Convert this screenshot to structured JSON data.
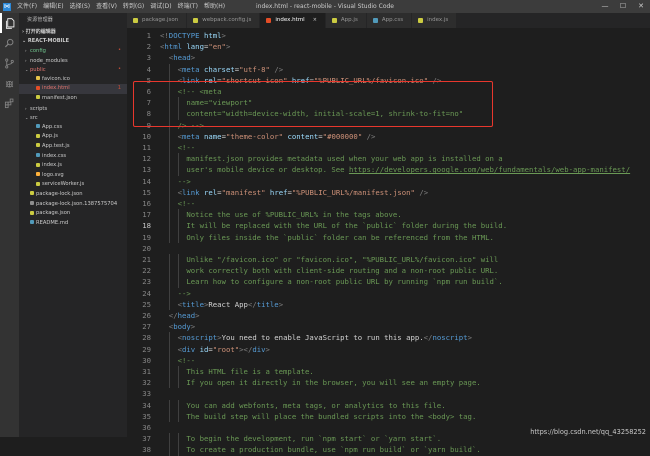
{
  "titlebar": {
    "menu": [
      "文件(F)",
      "编辑(E)",
      "选择(S)",
      "查看(V)",
      "转到(G)",
      "调试(D)",
      "终端(T)",
      "帮助(H)"
    ],
    "window_title": "index.html - react-mobile - Visual Studio Code",
    "min": "—",
    "max": "☐",
    "close": "✕"
  },
  "activity_bar": [
    "files-icon",
    "search-icon",
    "source-control-icon",
    "debug-icon",
    "extensions-icon"
  ],
  "sidebar": {
    "title": "资源管理器",
    "open_editors": "› 打开的编辑器",
    "project": "⌄ REACT-MOBILE",
    "items": [
      {
        "label": "config",
        "indent": 1,
        "twisty": "›",
        "color": "green",
        "badge": "•",
        "type": "folder"
      },
      {
        "label": "node_modules",
        "indent": 1,
        "twisty": "›",
        "color": "def",
        "badge": "",
        "type": "folder"
      },
      {
        "label": "public",
        "indent": 1,
        "twisty": "⌄",
        "color": "red",
        "badge": "•",
        "type": "folder"
      },
      {
        "label": "favicon.ico",
        "indent": 2,
        "twisty": "",
        "color": "def",
        "badge": "",
        "type": "ico"
      },
      {
        "label": "index.html",
        "indent": 2,
        "twisty": "",
        "color": "red",
        "badge": "1",
        "type": "html",
        "selected": true
      },
      {
        "label": "manifest.json",
        "indent": 2,
        "twisty": "",
        "color": "def",
        "badge": "",
        "type": "json"
      },
      {
        "label": "scripts",
        "indent": 1,
        "twisty": "›",
        "color": "def",
        "badge": "",
        "type": "folder"
      },
      {
        "label": "src",
        "indent": 1,
        "twisty": "⌄",
        "color": "def",
        "badge": "",
        "type": "folder"
      },
      {
        "label": "App.css",
        "indent": 2,
        "twisty": "",
        "color": "def",
        "badge": "",
        "type": "css"
      },
      {
        "label": "App.js",
        "indent": 2,
        "twisty": "",
        "color": "def",
        "badge": "",
        "type": "js"
      },
      {
        "label": "App.test.js",
        "indent": 2,
        "twisty": "",
        "color": "def",
        "badge": "",
        "type": "js"
      },
      {
        "label": "index.css",
        "indent": 2,
        "twisty": "",
        "color": "def",
        "badge": "",
        "type": "css"
      },
      {
        "label": "index.js",
        "indent": 2,
        "twisty": "",
        "color": "def",
        "badge": "",
        "type": "js"
      },
      {
        "label": "logo.svg",
        "indent": 2,
        "twisty": "",
        "color": "def",
        "badge": "",
        "type": "svg"
      },
      {
        "label": "serviceWorker.js",
        "indent": 2,
        "twisty": "",
        "color": "def",
        "badge": "",
        "type": "js"
      },
      {
        "label": "package-lock.json",
        "indent": 1,
        "twisty": "",
        "color": "def",
        "badge": "",
        "type": "json"
      },
      {
        "label": "package-lock.json.1387575704",
        "indent": 1,
        "twisty": "",
        "color": "def",
        "badge": "",
        "type": "file"
      },
      {
        "label": "package.json",
        "indent": 1,
        "twisty": "",
        "color": "def",
        "badge": "",
        "type": "json"
      },
      {
        "label": "README.md",
        "indent": 1,
        "twisty": "",
        "color": "def",
        "badge": "",
        "type": "md"
      }
    ]
  },
  "tabs": [
    {
      "label": "package.json",
      "type": "json",
      "active": false
    },
    {
      "label": "webpack.config.js",
      "type": "js",
      "active": false
    },
    {
      "label": "index.html",
      "type": "html",
      "active": true,
      "close": "×"
    },
    {
      "label": "App.js",
      "type": "js",
      "active": false
    },
    {
      "label": "App.css",
      "type": "css",
      "active": false
    },
    {
      "label": "index.js",
      "type": "js",
      "active": false
    }
  ],
  "editor": {
    "current_line": 18,
    "lines": [
      {
        "n": 1,
        "indent": 0,
        "tokens": [
          [
            "t-punc",
            "<!"
          ],
          [
            "t-tag",
            "DOCTYPE"
          ],
          [
            "t-text",
            " "
          ],
          [
            "t-attr",
            "html"
          ],
          [
            "t-punc",
            ">"
          ]
        ]
      },
      {
        "n": 2,
        "indent": 0,
        "tokens": [
          [
            "t-punc",
            "<"
          ],
          [
            "t-tag",
            "html"
          ],
          [
            "t-text",
            " "
          ],
          [
            "t-attr",
            "lang"
          ],
          [
            "t-text",
            "="
          ],
          [
            "t-str",
            "\"en\""
          ],
          [
            "t-punc",
            ">"
          ]
        ]
      },
      {
        "n": 3,
        "indent": 1,
        "tokens": [
          [
            "t-punc",
            "<"
          ],
          [
            "t-tag",
            "head"
          ],
          [
            "t-punc",
            ">"
          ]
        ]
      },
      {
        "n": 4,
        "indent": 2,
        "tokens": [
          [
            "t-punc",
            "<"
          ],
          [
            "t-tag",
            "meta"
          ],
          [
            "t-text",
            " "
          ],
          [
            "t-attr",
            "charset"
          ],
          [
            "t-text",
            "="
          ],
          [
            "t-str",
            "\"utf-8\""
          ],
          [
            "t-text",
            " "
          ],
          [
            "t-punc",
            "/>"
          ]
        ]
      },
      {
        "n": 5,
        "indent": 2,
        "tokens": [
          [
            "t-punc",
            "<"
          ],
          [
            "t-tag",
            "link"
          ],
          [
            "t-text",
            " "
          ],
          [
            "t-attr",
            "rel"
          ],
          [
            "t-text",
            "="
          ],
          [
            "t-str",
            "\"shortcut icon\""
          ],
          [
            "t-text",
            " "
          ],
          [
            "t-attr",
            "href"
          ],
          [
            "t-text",
            "="
          ],
          [
            "t-str",
            "\"%PUBLIC_URL%/favicon.ico\""
          ],
          [
            "t-text",
            " "
          ],
          [
            "t-punc",
            "/>"
          ]
        ]
      },
      {
        "n": 6,
        "indent": 2,
        "tokens": [
          [
            "t-com",
            "<!-- <meta"
          ]
        ]
      },
      {
        "n": 7,
        "indent": 3,
        "tokens": [
          [
            "t-com",
            "name=\"viewport\""
          ]
        ]
      },
      {
        "n": 8,
        "indent": 3,
        "tokens": [
          [
            "t-com",
            "content=\"width=device-width, initial-scale=1, shrink-to-fit=no\""
          ]
        ]
      },
      {
        "n": 9,
        "indent": 2,
        "tokens": [
          [
            "t-com",
            "/> -->"
          ]
        ]
      },
      {
        "n": 10,
        "indent": 2,
        "tokens": [
          [
            "t-punc",
            "<"
          ],
          [
            "t-tag",
            "meta"
          ],
          [
            "t-text",
            " "
          ],
          [
            "t-attr",
            "name"
          ],
          [
            "t-text",
            "="
          ],
          [
            "t-str",
            "\"theme-color\""
          ],
          [
            "t-text",
            " "
          ],
          [
            "t-attr",
            "content"
          ],
          [
            "t-text",
            "="
          ],
          [
            "t-str",
            "\"#000000\""
          ],
          [
            "t-text",
            " "
          ],
          [
            "t-punc",
            "/>"
          ]
        ]
      },
      {
        "n": 11,
        "indent": 2,
        "tokens": [
          [
            "t-com",
            "<!--"
          ]
        ]
      },
      {
        "n": 12,
        "indent": 3,
        "tokens": [
          [
            "t-com",
            "manifest.json provides metadata used when your web app is installed on a"
          ]
        ]
      },
      {
        "n": 13,
        "indent": 3,
        "tokens": [
          [
            "t-com",
            "user's mobile device or desktop. See "
          ],
          [
            "t-link",
            "https://developers.google.com/web/fundamentals/web-app-manifest/"
          ]
        ]
      },
      {
        "n": 14,
        "indent": 2,
        "tokens": [
          [
            "t-com",
            "-->"
          ]
        ]
      },
      {
        "n": 15,
        "indent": 2,
        "tokens": [
          [
            "t-punc",
            "<"
          ],
          [
            "t-tag",
            "link"
          ],
          [
            "t-text",
            " "
          ],
          [
            "t-attr",
            "rel"
          ],
          [
            "t-text",
            "="
          ],
          [
            "t-str",
            "\"manifest\""
          ],
          [
            "t-text",
            " "
          ],
          [
            "t-attr",
            "href"
          ],
          [
            "t-text",
            "="
          ],
          [
            "t-str",
            "\"%PUBLIC_URL%/manifest.json\""
          ],
          [
            "t-text",
            " "
          ],
          [
            "t-punc",
            "/>"
          ]
        ]
      },
      {
        "n": 16,
        "indent": 2,
        "tokens": [
          [
            "t-com",
            "<!--"
          ]
        ]
      },
      {
        "n": 17,
        "indent": 3,
        "tokens": [
          [
            "t-com",
            "Notice the use of %PUBLIC_URL% in the tags above."
          ]
        ]
      },
      {
        "n": 18,
        "indent": 3,
        "tokens": [
          [
            "t-com",
            "It will be replaced with the URL of the `public` folder during the build."
          ]
        ]
      },
      {
        "n": 19,
        "indent": 3,
        "tokens": [
          [
            "t-com",
            "Only files inside the `public` folder can be referenced from the HTML."
          ]
        ]
      },
      {
        "n": 20,
        "indent": 0,
        "tokens": []
      },
      {
        "n": 21,
        "indent": 3,
        "tokens": [
          [
            "t-com",
            "Unlike \"/favicon.ico\" or \"favicon.ico\", \"%PUBLIC_URL%/favicon.ico\" will"
          ]
        ]
      },
      {
        "n": 22,
        "indent": 3,
        "tokens": [
          [
            "t-com",
            "work correctly both with client-side routing and a non-root public URL."
          ]
        ]
      },
      {
        "n": 23,
        "indent": 3,
        "tokens": [
          [
            "t-com",
            "Learn how to configure a non-root public URL by running `npm run build`."
          ]
        ]
      },
      {
        "n": 24,
        "indent": 2,
        "tokens": [
          [
            "t-com",
            "-->"
          ]
        ]
      },
      {
        "n": 25,
        "indent": 2,
        "tokens": [
          [
            "t-punc",
            "<"
          ],
          [
            "t-tag",
            "title"
          ],
          [
            "t-punc",
            ">"
          ],
          [
            "t-text",
            "React App"
          ],
          [
            "t-punc",
            "</"
          ],
          [
            "t-tag",
            "title"
          ],
          [
            "t-punc",
            ">"
          ]
        ]
      },
      {
        "n": 26,
        "indent": 1,
        "tokens": [
          [
            "t-punc",
            "</"
          ],
          [
            "t-tag",
            "head"
          ],
          [
            "t-punc",
            ">"
          ]
        ]
      },
      {
        "n": 27,
        "indent": 1,
        "tokens": [
          [
            "t-punc",
            "<"
          ],
          [
            "t-tag",
            "body"
          ],
          [
            "t-punc",
            ">"
          ]
        ]
      },
      {
        "n": 28,
        "indent": 2,
        "tokens": [
          [
            "t-punc",
            "<"
          ],
          [
            "t-tag",
            "noscript"
          ],
          [
            "t-punc",
            ">"
          ],
          [
            "t-text",
            "You need to enable JavaScript to run this app."
          ],
          [
            "t-punc",
            "</"
          ],
          [
            "t-tag",
            "noscript"
          ],
          [
            "t-punc",
            ">"
          ]
        ]
      },
      {
        "n": 29,
        "indent": 2,
        "tokens": [
          [
            "t-punc",
            "<"
          ],
          [
            "t-tag",
            "div"
          ],
          [
            "t-text",
            " "
          ],
          [
            "t-attr",
            "id"
          ],
          [
            "t-text",
            "="
          ],
          [
            "t-str",
            "\"root\""
          ],
          [
            "t-punc",
            "></"
          ],
          [
            "t-tag",
            "div"
          ],
          [
            "t-punc",
            ">"
          ]
        ]
      },
      {
        "n": 30,
        "indent": 2,
        "tokens": [
          [
            "t-com",
            "<!--"
          ]
        ]
      },
      {
        "n": 31,
        "indent": 3,
        "tokens": [
          [
            "t-com",
            "This HTML file is a template."
          ]
        ]
      },
      {
        "n": 32,
        "indent": 3,
        "tokens": [
          [
            "t-com",
            "If you open it directly in the browser, you will see an empty page."
          ]
        ]
      },
      {
        "n": 33,
        "indent": 0,
        "tokens": []
      },
      {
        "n": 34,
        "indent": 3,
        "tokens": [
          [
            "t-com",
            "You can add webfonts, meta tags, or analytics to this file."
          ]
        ]
      },
      {
        "n": 35,
        "indent": 3,
        "tokens": [
          [
            "t-com",
            "The build step will place the bundled scripts into the <body> tag."
          ]
        ]
      },
      {
        "n": 36,
        "indent": 0,
        "tokens": []
      },
      {
        "n": 37,
        "indent": 3,
        "tokens": [
          [
            "t-com",
            "To begin the development, run `npm start` or `yarn start`."
          ]
        ]
      },
      {
        "n": 38,
        "indent": 3,
        "tokens": [
          [
            "t-com",
            "To create a production bundle, use `npm run build` or `yarn build`."
          ]
        ]
      }
    ]
  },
  "watermark": "https://blog.csdn.net/qq_43258252",
  "colors": {
    "highlight_box": "#e8372d",
    "accent": "#007acc"
  }
}
